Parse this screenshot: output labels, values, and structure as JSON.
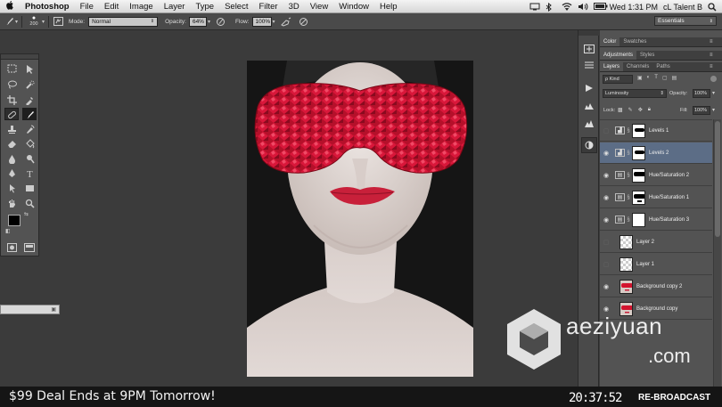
{
  "menubar": {
    "apple": "",
    "items": [
      "Photoshop",
      "File",
      "Edit",
      "Image",
      "Layer",
      "Type",
      "Select",
      "Filter",
      "3D",
      "View",
      "Window",
      "Help"
    ],
    "clock": "Wed 1:31 PM",
    "user": "cL Talent B"
  },
  "options": {
    "brush_size": "200",
    "mode_label": "Mode:",
    "mode_value": "Normal",
    "opacity_label": "Opacity:",
    "opacity_value": "64%",
    "flow_label": "Flow:",
    "flow_value": "100%",
    "workspace": "Essentials"
  },
  "panels": {
    "top_tabs": [
      "Color",
      "Swatches"
    ],
    "adj_tabs": [
      "Adjustments",
      "Styles"
    ],
    "layer_tabs": [
      "Layers",
      "Channels",
      "Paths"
    ],
    "kind_label": "ρ Kind",
    "blend_mode": "Luminosity",
    "opacity_label": "Opacity:",
    "opacity_value": "100%",
    "lock_label": "Lock:",
    "fill_label": "Fill:",
    "fill_value": "100%"
  },
  "layers": [
    {
      "name": "Levels 1",
      "visible": false,
      "type": "adjustment",
      "icon": "levels-icon"
    },
    {
      "name": "Levels 2",
      "visible": true,
      "type": "adjustment",
      "icon": "levels-icon",
      "selected": true
    },
    {
      "name": "Hue/Saturation 2",
      "visible": true,
      "type": "adjustment",
      "icon": "hue-sat-icon"
    },
    {
      "name": "Hue/Saturation 1",
      "visible": true,
      "type": "adjustment",
      "icon": "hue-sat-icon"
    },
    {
      "name": "Hue/Saturation 3",
      "visible": true,
      "type": "adjustment",
      "icon": "hue-sat-icon"
    },
    {
      "name": "Layer 2",
      "visible": false,
      "type": "pixel"
    },
    {
      "name": "Layer 1",
      "visible": false,
      "type": "pixel"
    },
    {
      "name": "Background copy 2",
      "visible": true,
      "type": "image"
    },
    {
      "name": "Background copy",
      "visible": true,
      "type": "image"
    }
  ],
  "bottom": {
    "ticker": "$99 Deal Ends at 9PM Tomorrow!",
    "clock": "20:37:52",
    "rebroadcast": "RE-BROADCAST"
  },
  "watermark": {
    "line1": "aeziyuan",
    "line2": ".com"
  },
  "colors": {
    "accent_selected": "#5c6d86",
    "lips": "#c8203a",
    "gems": "#d3142e"
  }
}
